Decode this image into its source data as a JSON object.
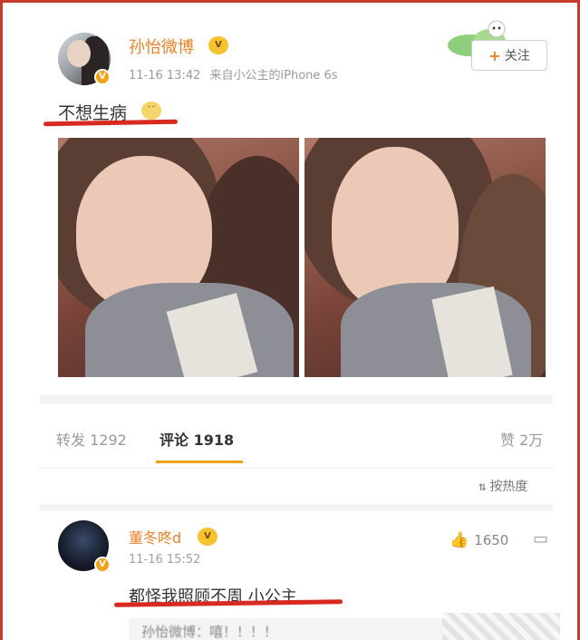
{
  "post": {
    "username": "孙怡微博",
    "timestamp": "11-16 13:42",
    "source": "来自小公主的iPhone 6s",
    "text": "不想生病",
    "follow_label": "关注",
    "follow_icon": "plus-icon"
  },
  "tabs": {
    "repost": "转发 1292",
    "comments": "评论 1918",
    "likes": "赞 2万"
  },
  "sort": {
    "label": "按热度",
    "icon": "sort-icon"
  },
  "comment": {
    "username": "董冬咚d",
    "timestamp": "11-16 15:52",
    "like_count": "1650",
    "text": "都怪我照顾不周 小公主",
    "reply_preview": "孙怡微博：嘻！！！！"
  },
  "colors": {
    "accent": "#e8832a",
    "highlight_underline": "#d82a20",
    "active_tab_underline": "#f0a31a",
    "frame_border": "#c83a2e"
  }
}
